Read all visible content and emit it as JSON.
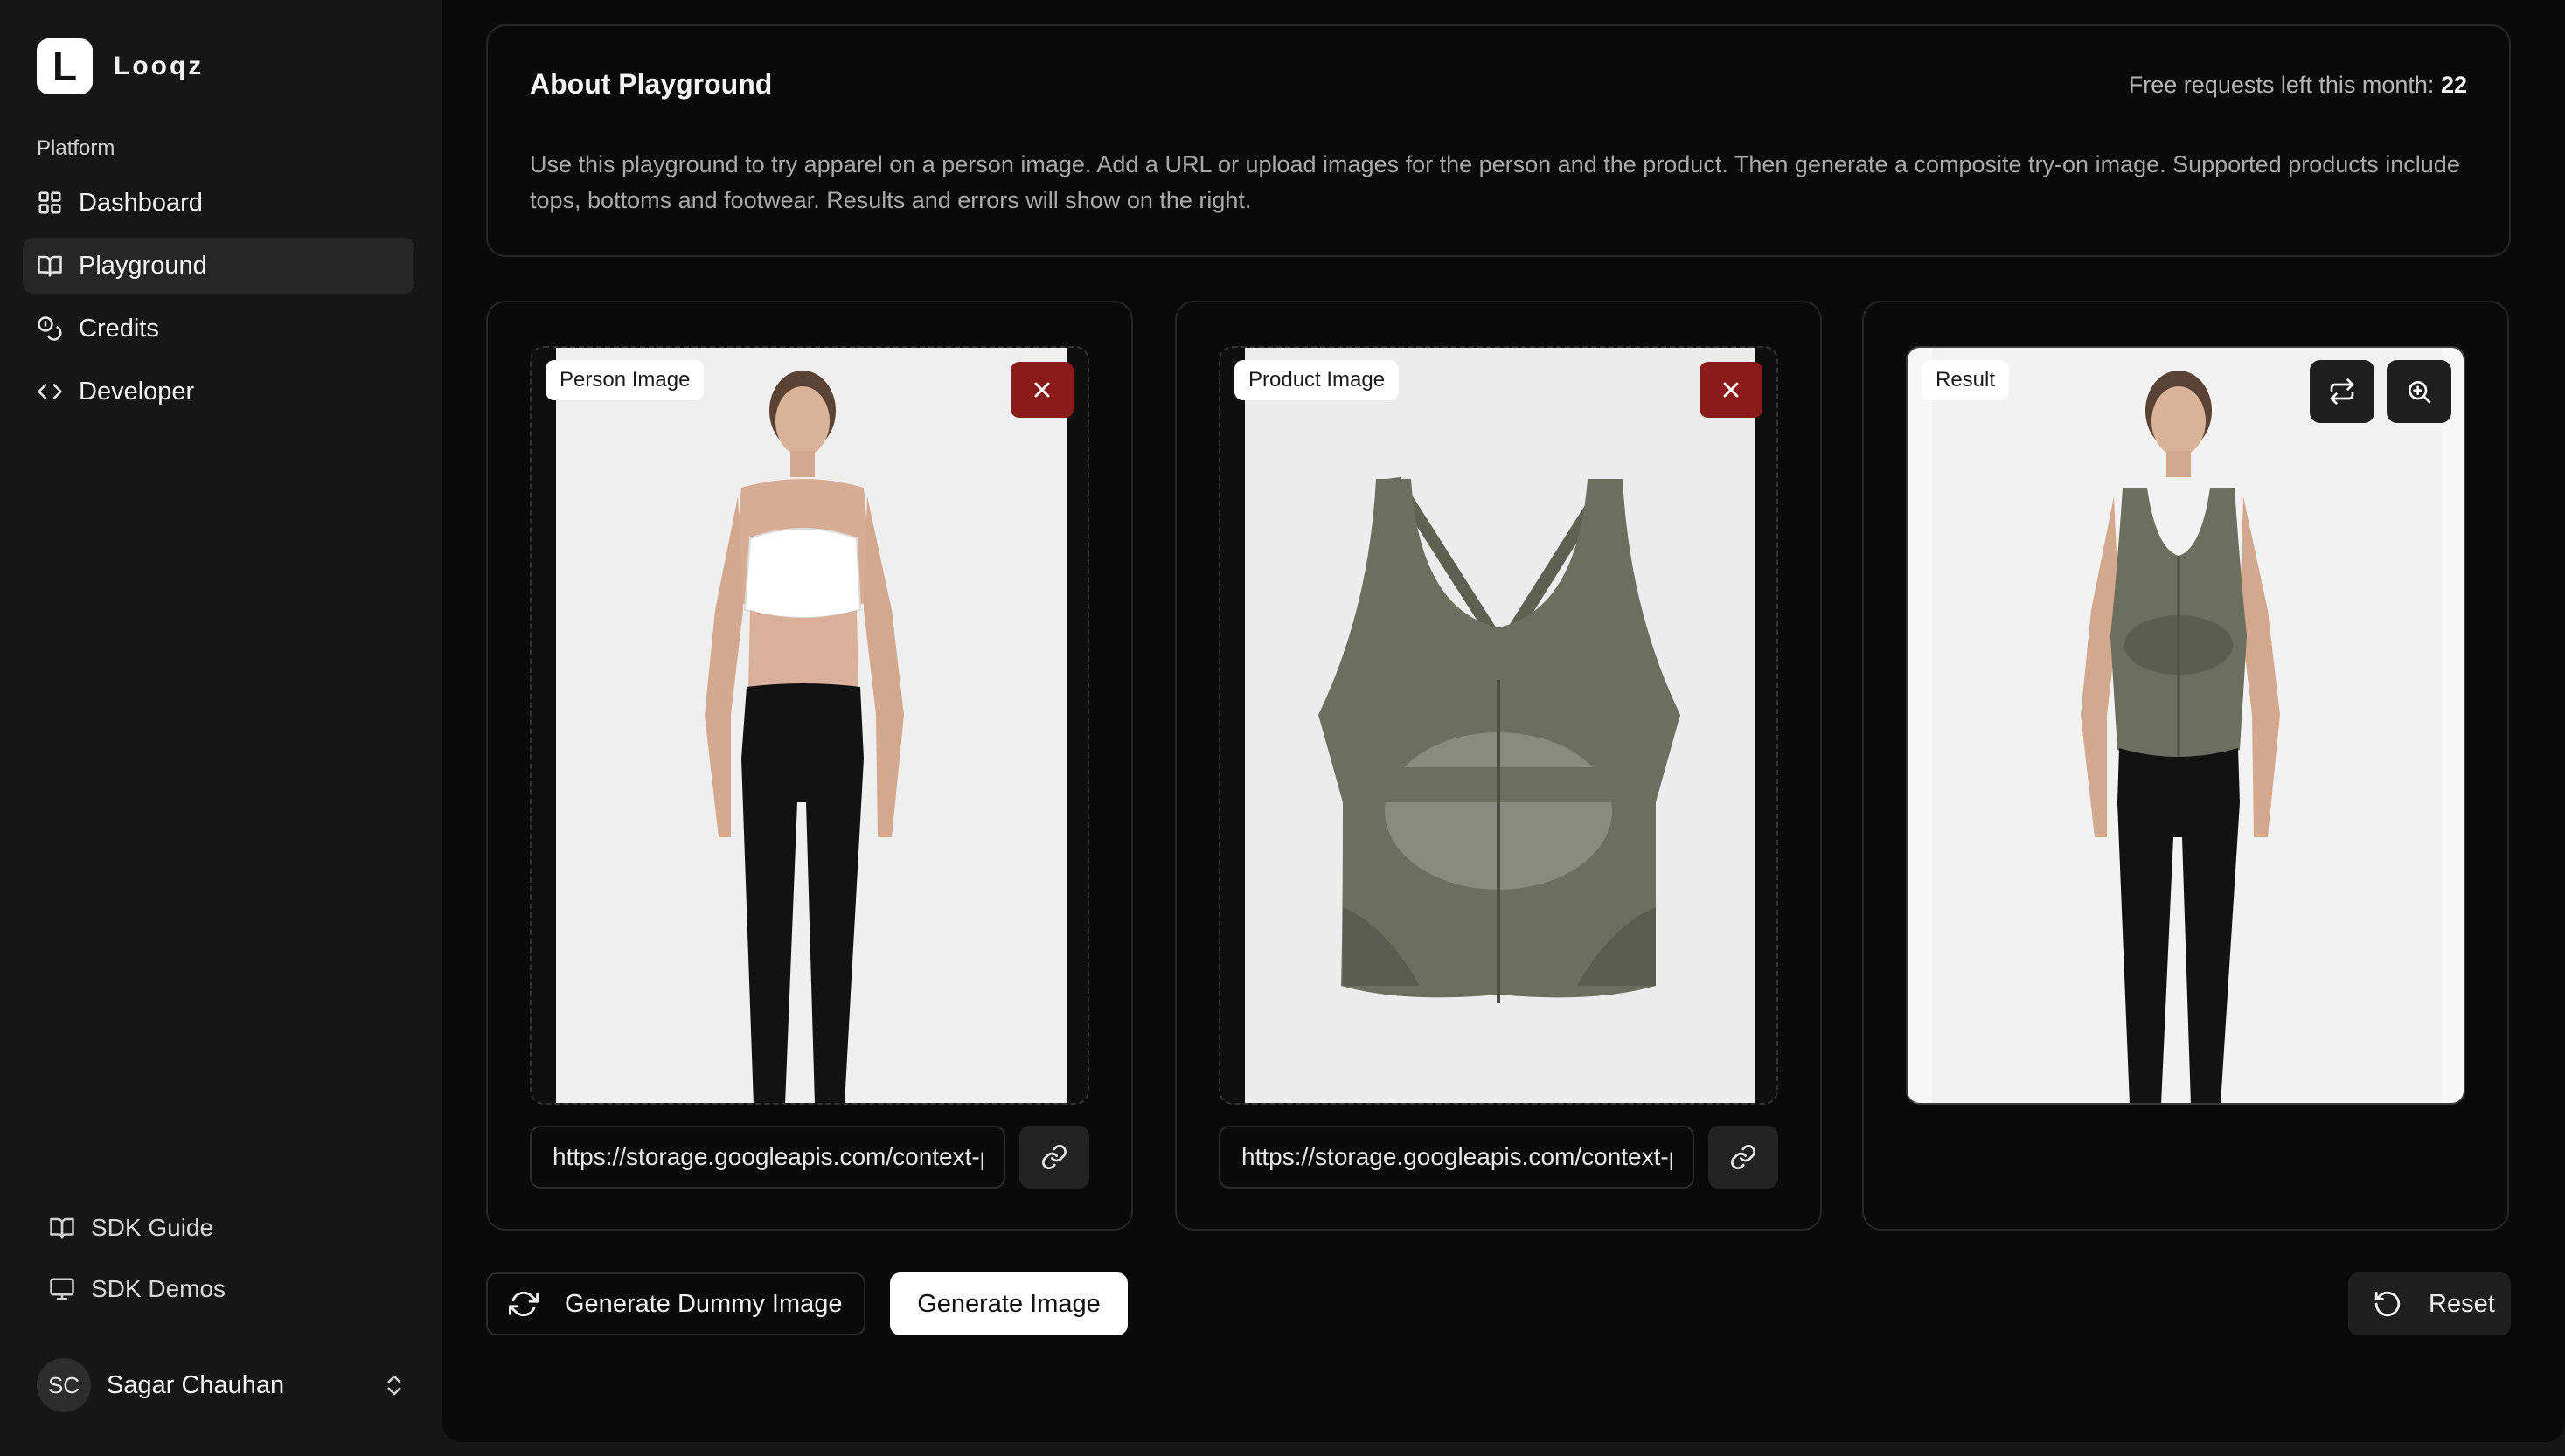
{
  "brand": {
    "logo_letter": "L",
    "name": "Looqz"
  },
  "sidebar": {
    "section_label": "Platform",
    "items": [
      {
        "label": "Dashboard",
        "icon": "grid-icon"
      },
      {
        "label": "Playground",
        "icon": "book-open-icon",
        "active": true
      },
      {
        "label": "Credits",
        "icon": "coins-icon"
      },
      {
        "label": "Developer",
        "icon": "code-icon"
      }
    ],
    "bottom_items": [
      {
        "label": "SDK Guide",
        "icon": "book-open-icon"
      },
      {
        "label": "SDK Demos",
        "icon": "monitor-icon"
      }
    ],
    "user": {
      "initials": "SC",
      "name": "Sagar Chauhan"
    }
  },
  "about": {
    "title": "About Playground",
    "requests_label": "Free requests left this month:",
    "requests_count": "22",
    "description": "Use this playground to try apparel on a person image. Add a URL or upload images for the person and the product. Then generate a composite try-on image. Supported products include tops, bottoms and footwear. Results and errors will show on the right."
  },
  "person": {
    "tag": "Person Image",
    "url": "https://storage.googleapis.com/context-person-image.png"
  },
  "product": {
    "tag": "Product Image",
    "url": "https://storage.googleapis.com/context-product-image.png"
  },
  "result": {
    "tag": "Result"
  },
  "actions": {
    "dummy_label": "Generate Dummy Image",
    "generate_label": "Generate Image",
    "reset_label": "Reset"
  },
  "colors": {
    "background": "#0a0a0a",
    "sidebar": "#161616",
    "remove_button": "#8b1a1a",
    "garment": "#6c6e5f"
  }
}
